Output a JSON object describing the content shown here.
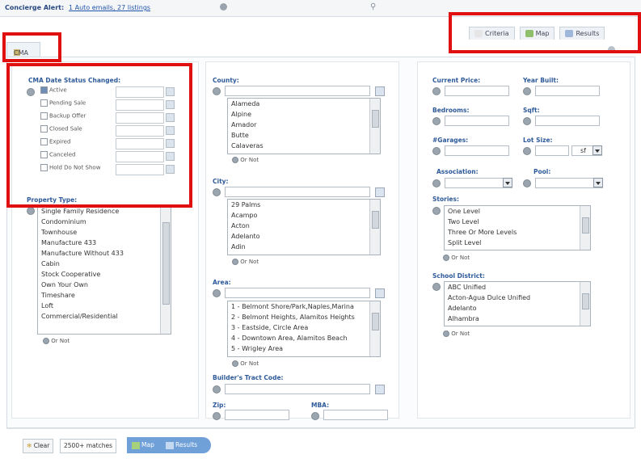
{
  "topbar": {
    "title": "Concierge Alert:",
    "link": "1 Auto emails, 27 listings"
  },
  "tabs": [
    {
      "label": "Criteria",
      "color": "#e6e6e6"
    },
    {
      "label": "Map",
      "color": "#8fbf6a"
    },
    {
      "label": "Results",
      "color": "#9fb7d9"
    }
  ],
  "cma_tab": "CMA",
  "status": {
    "title": "CMA Date Status Changed:",
    "items": [
      {
        "label": "Active",
        "checked": true
      },
      {
        "label": "Pending Sale",
        "checked": false
      },
      {
        "label": "Backup Offer",
        "checked": false
      },
      {
        "label": "Closed Sale",
        "checked": false
      },
      {
        "label": "Expired",
        "checked": false
      },
      {
        "label": "Canceled",
        "checked": false
      },
      {
        "label": "Hold Do Not Show",
        "checked": false
      }
    ]
  },
  "property_type": {
    "title": "Property Type:",
    "options": [
      "Single Family Residence",
      "Condominium",
      "Townhouse",
      "Manufacture 433",
      "Manufacture Without 433",
      "Cabin",
      "Stock Cooperative",
      "Own Your Own",
      "Timeshare",
      "Loft",
      "Commercial/Residential"
    ],
    "ornot": "Or  Not"
  },
  "county": {
    "title": "County:",
    "options": [
      "Alameda",
      "Alpine",
      "Amador",
      "Butte",
      "Calaveras"
    ],
    "ornot": "Or  Not"
  },
  "city": {
    "title": "City:",
    "options": [
      "29 Palms",
      "Acampo",
      "Acton",
      "Adelanto",
      "Adin"
    ],
    "ornot": "Or  Not"
  },
  "area": {
    "title": "Area:",
    "options": [
      "1 - Belmont Shore/Park,Naples,Marina",
      "2 - Belmont Heights, Alamitos Heights",
      "3 - Eastside, Circle Area",
      "4 - Downtown Area, Alamitos Beach",
      "5 - Wrigley Area"
    ],
    "ornot": "Or  Not"
  },
  "builder": {
    "title": "Builder's Tract Code:"
  },
  "zip": {
    "title": "Zip:"
  },
  "mba": {
    "title": "MBA:"
  },
  "right": {
    "current_price": "Current Price:",
    "year_built": "Year Built:",
    "bedrooms": "Bedrooms:",
    "sqft": "Sqft:",
    "garages": "#Garages:",
    "lot_size": "Lot Size:",
    "lot_unit": "sf",
    "association": "Association:",
    "pool": "Pool:",
    "stories": {
      "title": "Stories:",
      "options": [
        "One Level",
        "Two Level",
        "Three Or More Levels",
        "Split Level"
      ],
      "ornot": "Or  Not"
    },
    "school": {
      "title": "School District:",
      "options": [
        "ABC Unified",
        "Acton-Agua Dulce Unified",
        "Adelanto",
        "Alhambra"
      ],
      "ornot": "Or  Not"
    }
  },
  "bottom": {
    "clear": "Clear",
    "matches": "2500+ matches",
    "map": "Map",
    "results": "Results"
  }
}
